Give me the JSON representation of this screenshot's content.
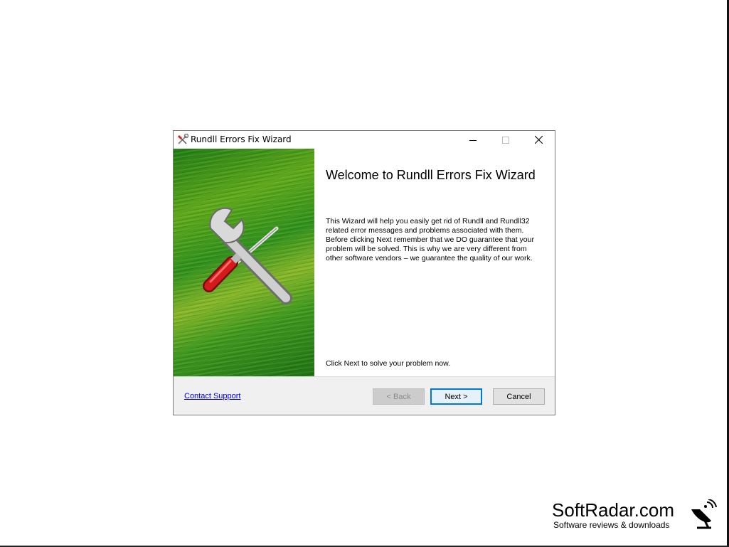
{
  "window": {
    "title": "Rundll Errors Fix Wizard",
    "icon": "tools-icon",
    "controls": [
      "minimize-icon",
      "maximize-icon",
      "close-icon"
    ]
  },
  "content": {
    "heading": "Welcome to Rundll Errors Fix Wizard",
    "body": "This Wizard will help you easily get rid of Rundll and Rundll32 related error messages and problems associated with them. Before clicking Next remember that we DO guarantee that your problem will be solved. This is why we are very different from other software vendors – we guarantee the quality of our work.",
    "hint": "Click Next to solve your problem now."
  },
  "footer": {
    "contact_label": "Contact Support",
    "back_label": "< Back",
    "next_label": "Next >",
    "cancel_label": "Cancel"
  },
  "banner": {
    "icon": "wrench-screwdriver-icon",
    "accent": "#3c961f"
  },
  "watermark": {
    "title": "SoftRadar.com",
    "subtitle": "Software reviews & downloads",
    "icon": "satellite-dish-icon"
  }
}
